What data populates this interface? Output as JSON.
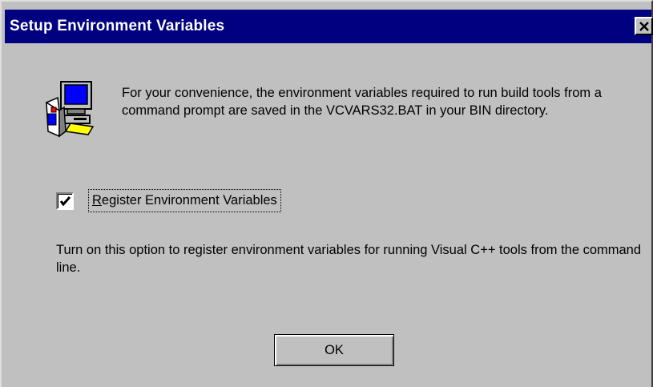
{
  "window": {
    "title": "Setup Environment Variables",
    "close_icon": "close-icon"
  },
  "intro": {
    "icon": "computer-setup-icon",
    "text": "For your convenience, the environment variables required to run build tools from a command prompt are saved in the VCVARS32.BAT in your BIN directory."
  },
  "option": {
    "checked": true,
    "label_mnemonic": "R",
    "label_rest": "egister Environment Variables"
  },
  "help": {
    "text": "Turn on this option to register environment variables for running Visual C++ tools from the command line."
  },
  "buttons": {
    "ok_label": "OK"
  },
  "colors": {
    "title_bar": "#000080",
    "face": "#c0c0c0"
  }
}
